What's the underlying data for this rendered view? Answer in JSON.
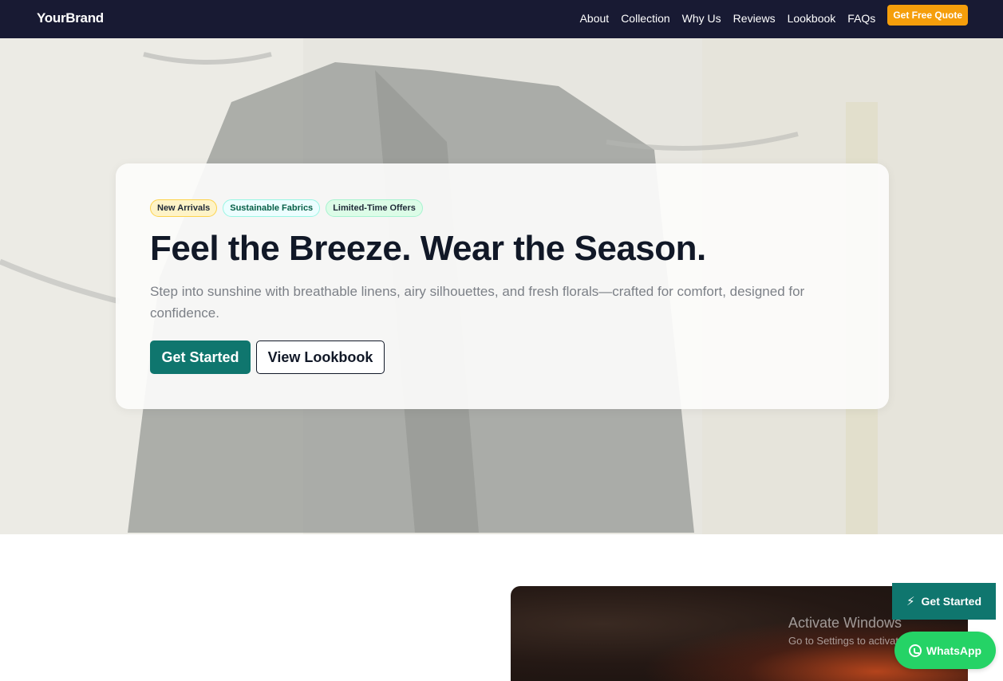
{
  "nav": {
    "brand": "YourBrand",
    "links": [
      "About",
      "Collection",
      "Why Us",
      "Reviews",
      "Lookbook",
      "FAQs"
    ],
    "cta": "Get Free Quote"
  },
  "hero": {
    "chips": [
      "New Arrivals",
      "Sustainable Fabrics",
      "Limited-Time Offers"
    ],
    "headline": "Feel the Breeze. Wear the Season.",
    "subtext": "Step into sunshine with breathable linens, airy silhouettes, and fresh florals—crafted for comfort, designed for confidence.",
    "primary_cta": "Get Started",
    "secondary_cta": "View Lookbook"
  },
  "floating": {
    "get_started": "Get Started",
    "whatsapp": "WhatsApp"
  },
  "watermark": {
    "title": "Activate Windows",
    "subtitle": "Go to Settings to activate Windows."
  },
  "colors": {
    "nav_bg": "#181a33",
    "accent": "#0f766e",
    "quote": "#f59e0b",
    "whatsapp": "#25d366"
  }
}
